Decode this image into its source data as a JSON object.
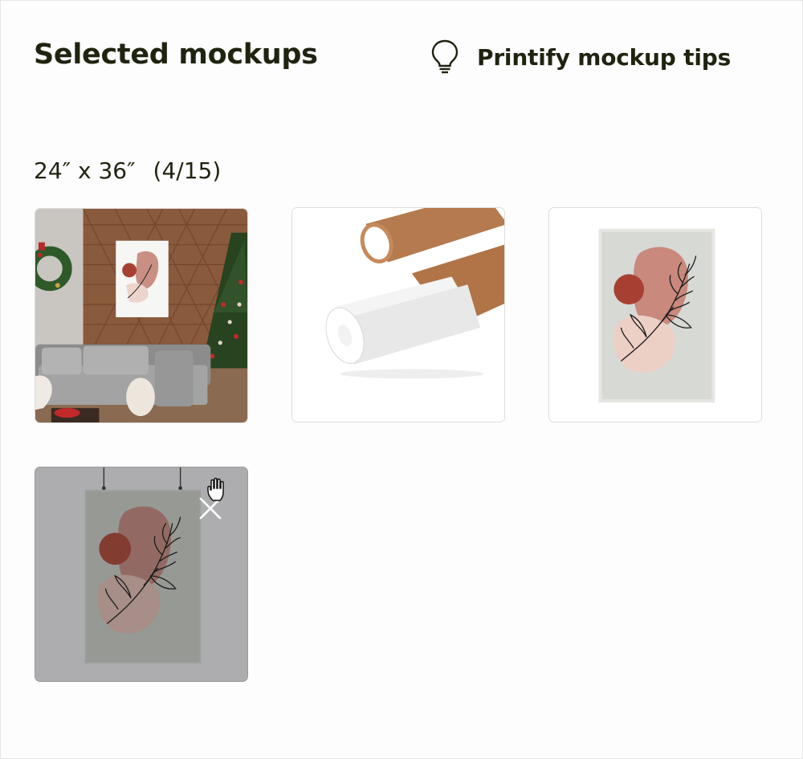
{
  "header": {
    "title": "Selected mockups",
    "tips_label": "Printify mockup tips"
  },
  "group": {
    "size_label": "24″ x 36″",
    "count_label": "(4/15)"
  },
  "mockups": [
    {
      "scene": "christmas-living-room"
    },
    {
      "scene": "poster-tubes"
    },
    {
      "scene": "flat-poster"
    },
    {
      "scene": "hanging-poster",
      "state": "hovered"
    }
  ],
  "colors": {
    "text": "#1f2410",
    "card_border": "#dcdcdc",
    "hover_overlay": "#adadb0"
  },
  "icons": [
    "lightbulb-icon",
    "close-icon",
    "hand-pointer-icon"
  ]
}
